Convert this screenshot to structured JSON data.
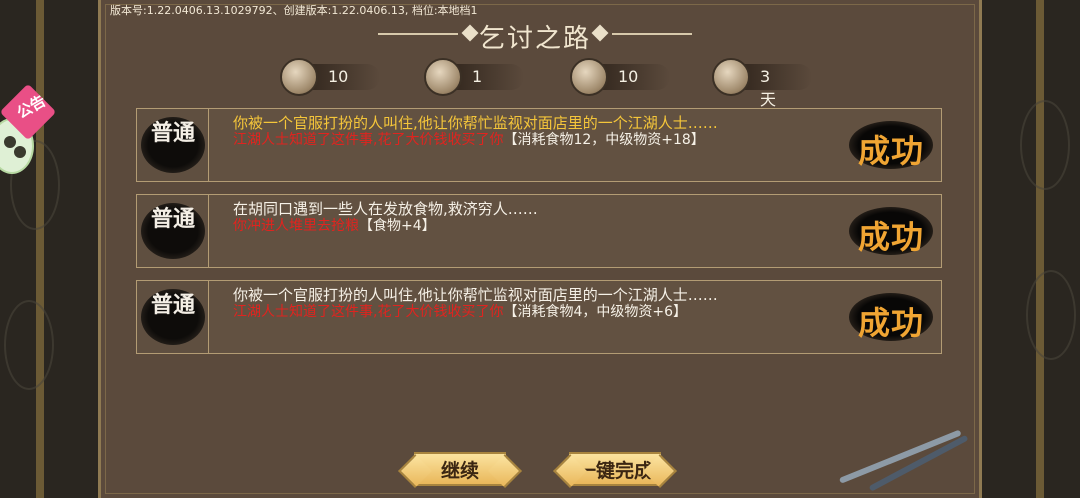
{
  "version_info": "版本号:1.22.0406.13.1029792、创建版本:1.22.0406.13, 档位:本地档1",
  "title": "乞讨之路",
  "resources": [
    {
      "icon": "scroll-icon",
      "value": "10"
    },
    {
      "icon": "food-bowl-icon",
      "value": "1"
    },
    {
      "icon": "bandage-icon",
      "value": "10"
    },
    {
      "icon": "calendar-days-icon",
      "value": "3天"
    }
  ],
  "events": [
    {
      "badge": "普通",
      "line1": "你被一个官服打扮的人叫住,他让你帮忙监视对面店里的一个江湖人士……",
      "line2_red": "江湖人士知道了这件事,花了大价钱收买了你",
      "line2_white": "【消耗食物12，中级物资+18】",
      "result": "成功",
      "line1_color": "yellow"
    },
    {
      "badge": "普通",
      "line1": "在胡同口遇到一些人在发放食物,救济穷人……",
      "line2_red": "你冲进人堆里去抢粮",
      "line2_white": "【食物+4】",
      "result": "成功",
      "line1_color": "white"
    },
    {
      "badge": "普通",
      "line1": "你被一个官服打扮的人叫住,他让你帮忙监视对面店里的一个江湖人士……",
      "line2_red": "江湖人士知道了这件事,花了大价钱收买了你",
      "line2_white": "【消耗食物4，中级物资+6】",
      "result": "成功",
      "line1_color": "white"
    }
  ],
  "buttons": {
    "continue": "继续",
    "complete": "一键完成"
  },
  "notice_label": "公告",
  "colors": {
    "highlight_yellow": "#f5c63a",
    "result_orange": "#f0a533",
    "warning_red": "#e0241f",
    "panel_bg": "#5b4a3c"
  }
}
